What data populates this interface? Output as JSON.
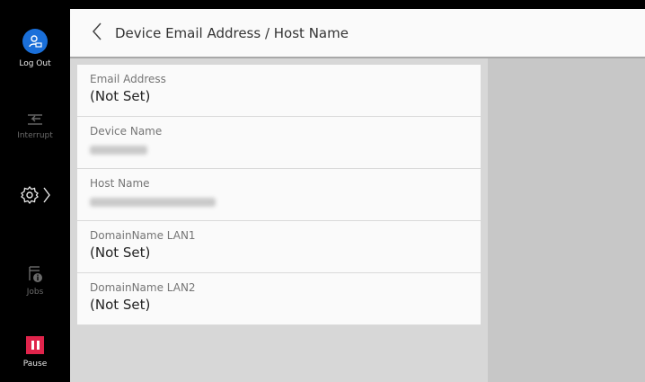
{
  "sidebar": {
    "logout_label": "Log Out",
    "interrupt_label": "Interrupt",
    "jobs_label": "Jobs",
    "pause_label": "Pause"
  },
  "header": {
    "title": "Device Email Address / Host Name"
  },
  "list": [
    {
      "label": "Email Address",
      "value": "(Not Set)"
    },
    {
      "label": "Device Name",
      "value": ""
    },
    {
      "label": "Host Name",
      "value": ""
    },
    {
      "label": "DomainName LAN1",
      "value": "(Not Set)"
    },
    {
      "label": "DomainName LAN2",
      "value": "(Not Set)"
    }
  ],
  "colors": {
    "accent_blue": "#1a6fd9",
    "pause_red": "#e0244b"
  }
}
